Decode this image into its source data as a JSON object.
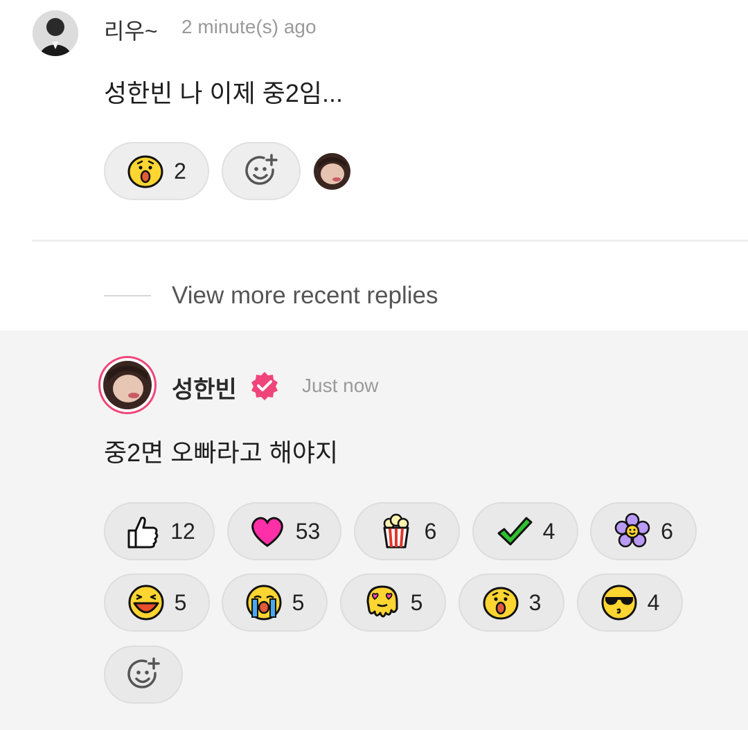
{
  "comment": {
    "author": "리우~",
    "time": "2 minute(s) ago",
    "text": "성한빈 나 이제 중2임...",
    "reaction": {
      "icon": "surprised-emoji",
      "count": "2"
    },
    "add_reaction_icon": "add-reaction-icon"
  },
  "view_more": "View more recent replies",
  "reply": {
    "author": "성한빈",
    "verified_color": "#f0457a",
    "time": "Just now",
    "text": "중2면 오빠라고 해야지",
    "reactions": [
      {
        "icon": "thumbs-up-emoji",
        "count": "12"
      },
      {
        "icon": "heart-emoji",
        "count": "53"
      },
      {
        "icon": "popcorn-emoji",
        "count": "6"
      },
      {
        "icon": "checkmark-emoji",
        "count": "4"
      },
      {
        "icon": "flower-emoji",
        "count": "6"
      },
      {
        "icon": "laughing-emoji",
        "count": "5"
      },
      {
        "icon": "crying-emoji",
        "count": "5"
      },
      {
        "icon": "melting-heart-eyes-emoji",
        "count": "5"
      },
      {
        "icon": "surprised-emoji",
        "count": "3"
      },
      {
        "icon": "sunglasses-kiss-emoji",
        "count": "4"
      }
    ]
  }
}
